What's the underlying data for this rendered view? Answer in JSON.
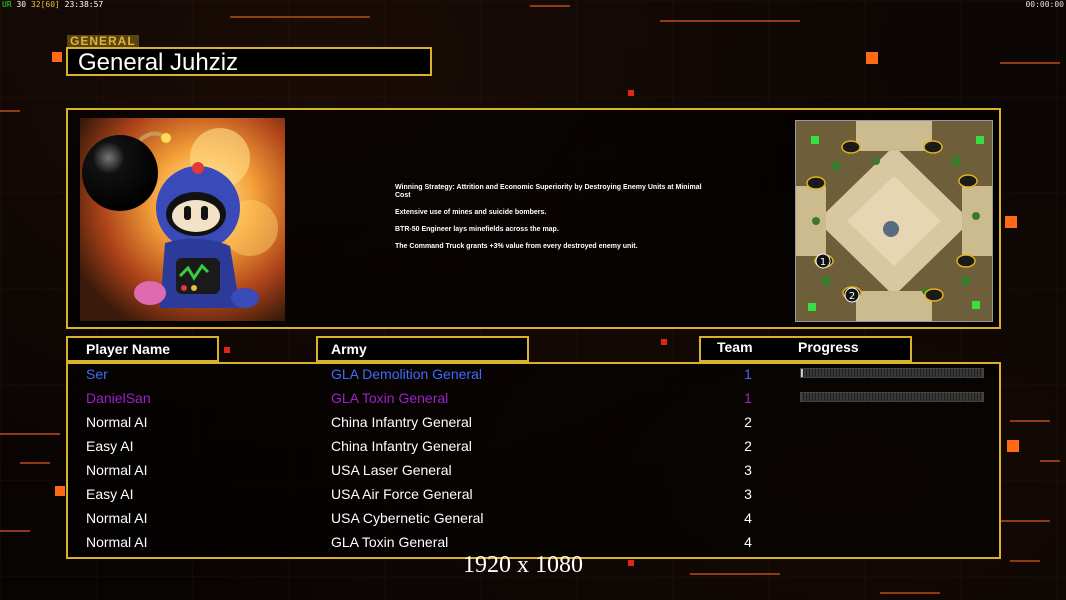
{
  "topbar": {
    "p1": "UR",
    "p2": "30",
    "p3": "32",
    "p4": "[60]",
    "p5": "23:38:57"
  },
  "clock": "00:00:00",
  "general": {
    "section_label": "GENERAL",
    "title": "General Juhziz",
    "portrait_icon": "bomberman-portrait",
    "strategy": [
      "Winning Strategy: Attrition and Economic Superiority by Destroying Enemy Units at Minimal Cost",
      "Extensive use of mines and suicide bombers.",
      "BTR-50 Engineer lays minefields across the map.",
      "The Command Truck grants +3% value from every destroyed enemy unit."
    ]
  },
  "minimap": {
    "markers": [
      "1",
      "2"
    ],
    "icon": "map-minimap"
  },
  "columns": {
    "player": "Player Name",
    "army": "Army",
    "team": "Team",
    "progress": "Progress"
  },
  "players": [
    {
      "name": "Ser",
      "army": "GLA Demolition General",
      "team": "1",
      "progress": 0.01,
      "color": "#3f6bff"
    },
    {
      "name": "DanielSan",
      "army": "GLA Toxin General",
      "team": "1",
      "progress": 0.0,
      "color": "#a020c8"
    },
    {
      "name": "Normal AI",
      "army": "China Infantry General",
      "team": "2",
      "color": "#ffffff"
    },
    {
      "name": "Easy AI",
      "army": "China Infantry General",
      "team": "2",
      "color": "#ffffff"
    },
    {
      "name": "Normal AI",
      "army": "USA Laser General",
      "team": "3",
      "color": "#ffffff"
    },
    {
      "name": "Easy AI",
      "army": "USA Air Force General",
      "team": "3",
      "color": "#ffffff"
    },
    {
      "name": "Normal AI",
      "army": "USA Cybernetic General",
      "team": "4",
      "color": "#ffffff"
    },
    {
      "name": "Normal AI",
      "army": "GLA Toxin General",
      "team": "4",
      "color": "#ffffff"
    }
  ],
  "resolution": "1920 x 1080",
  "accent": "#d9b22a"
}
